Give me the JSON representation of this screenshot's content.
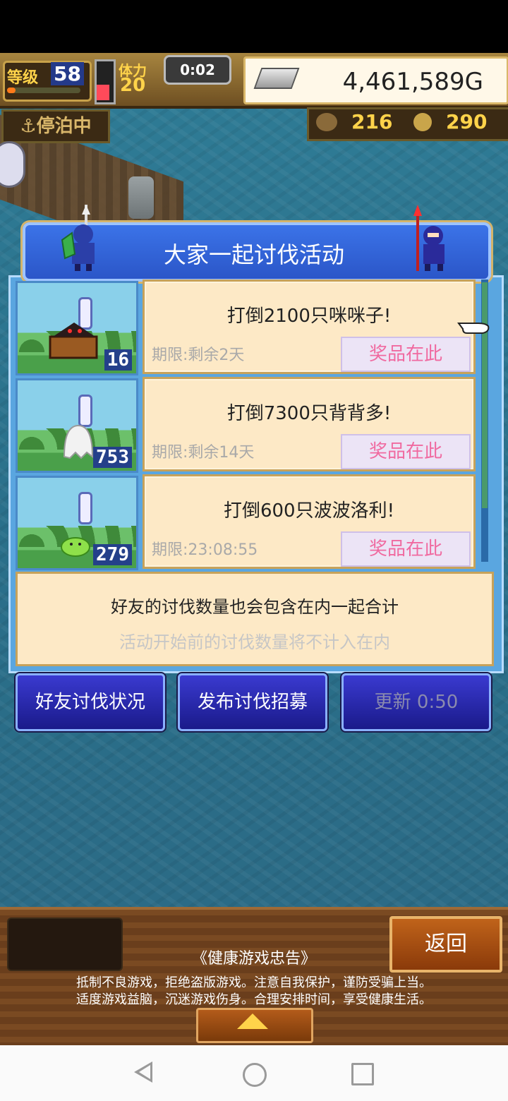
{
  "hud": {
    "level_label": "等级",
    "level": "58",
    "stamina_label": "体力",
    "stamina": "20",
    "timer": "0:02",
    "gold": "4,461,589G",
    "status": "停泊中",
    "resource_1": "216",
    "resource_2": "290"
  },
  "event": {
    "title": "大家一起讨伐活动",
    "quests": [
      {
        "title": "打倒2100只咪咪子!",
        "deadline": "期限:剩余2天",
        "prize_label": "奖品在此",
        "count": "16"
      },
      {
        "title": "打倒7300只背背多!",
        "deadline": "期限:剩余14天",
        "prize_label": "奖品在此",
        "count": "753"
      },
      {
        "title": "打倒600只波波洛利!",
        "deadline": "期限:23:08:55",
        "prize_label": "奖品在此",
        "count": "279"
      }
    ],
    "info_line1": "好友的讨伐数量也会包含在内一起合计",
    "info_line2": "活动开始前的讨伐数量将不计入在内"
  },
  "actions": {
    "friends": "好友讨伐状况",
    "recruit": "发布讨伐招募",
    "refresh": "更新 0:50"
  },
  "footer": {
    "back": "返回",
    "health_title": "《健康游戏忠告》",
    "health_line1": "抵制不良游戏，拒绝盗版游戏。注意自我保护，谨防受骗上当。",
    "health_line2": "适度游戏益脑，沉迷游戏伤身。合理安排时间，享受健康生活。"
  },
  "colors": {
    "banner": "#3b73e8",
    "card": "#fde9c6",
    "prize_text": "#f06aa0",
    "button": "#2a2ab0"
  }
}
